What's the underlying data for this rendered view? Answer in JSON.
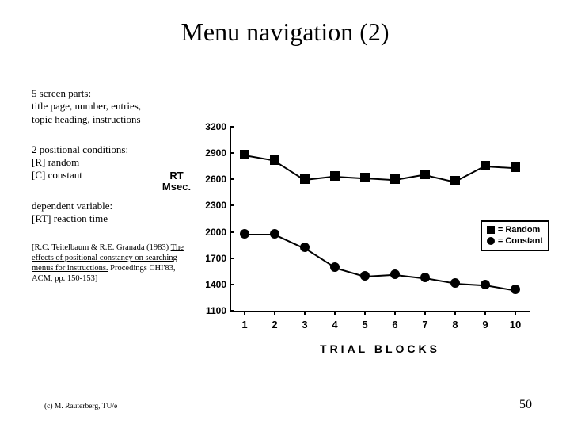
{
  "title": "Menu navigation (2)",
  "left": {
    "block1": {
      "l1": "5 screen parts:",
      "l2": "title page, number, entries,",
      "l3": "topic heading, instructions"
    },
    "block2": {
      "l1": "2 positional conditions:",
      "l2": "[R] random",
      "l3": "[C] constant"
    },
    "block3": {
      "l1": "dependent variable:",
      "l2": "[RT] reaction time"
    },
    "cite": {
      "pre": "[R.C. Teitelbaum & R.E. Granada (1983) ",
      "u": "The effects of positional constancy on searching menus for instructions.",
      "post": " Procedings CHI'83, ACM, pp. 150-153]"
    }
  },
  "footer": {
    "left": "(c) M. Rauterberg, TU/e",
    "right": "50"
  },
  "chart_data": {
    "type": "line",
    "title": "",
    "ylabel_l1": "RT",
    "ylabel_l2": "Msec.",
    "xlabel": "TRIAL BLOCKS",
    "ylim": [
      1100,
      3200
    ],
    "y_ticks": [
      3200,
      2900,
      2600,
      2300,
      2000,
      1700,
      1400,
      1100
    ],
    "categories": [
      1,
      2,
      3,
      4,
      5,
      6,
      7,
      8,
      9,
      10
    ],
    "series": [
      {
        "name": "Random",
        "marker": "square",
        "values": [
          2880,
          2820,
          2600,
          2640,
          2620,
          2600,
          2660,
          2580,
          2760,
          2740
        ]
      },
      {
        "name": "Constant",
        "marker": "circle",
        "values": [
          1980,
          1980,
          1820,
          1600,
          1500,
          1520,
          1480,
          1420,
          1400,
          1340
        ]
      }
    ],
    "legend": {
      "random_label": "= Random",
      "constant_label": "= Constant"
    }
  }
}
